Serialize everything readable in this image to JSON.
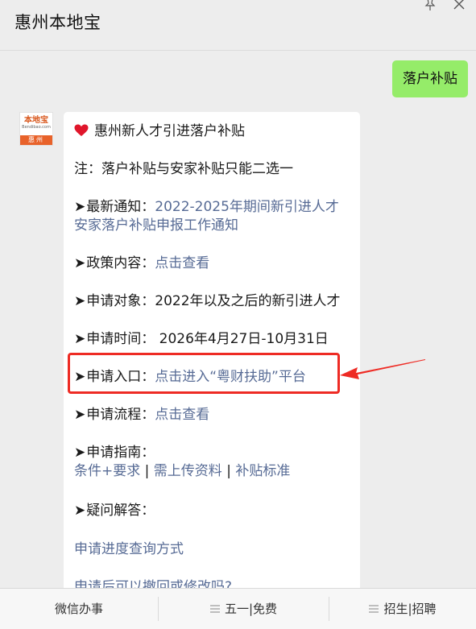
{
  "header": {
    "title": "惠州本地宝"
  },
  "chat": {
    "user_message": "落户补贴",
    "avatar": {
      "brand": "本地宝",
      "site": "Bendibao.com",
      "city": "惠州"
    },
    "reply": {
      "title": "惠州新人才引进落户补贴",
      "note": "注：落户补贴与安家补贴只能二选一",
      "arrow": "➤",
      "latest_label": "最新通知：",
      "latest_link_line1": "2022-2025年期间新引进人才",
      "latest_link_line2": "安家落户补贴申报工作通知",
      "policy_label": "政策内容：",
      "policy_link": "点击查看",
      "target_label": "申请对象：",
      "target_value": "2022年以及之后的新引进人才",
      "time_label": "申请时间：",
      "time_value": "2026年4月27日-10月31日",
      "entry_label": "申请入口：",
      "entry_link": "点击进入“粤财扶助”平台",
      "process_label": "申请流程：",
      "process_link": "点击查看",
      "guide_label": "申请指南：",
      "guide_link_1": "条件+要求",
      "guide_sep_1": " | ",
      "guide_link_2": "需上传资料",
      "guide_sep_2": " | ",
      "guide_link_3": "补贴标准",
      "faq_label": "疑问解答：",
      "faq_link_1": "申请进度查询方式",
      "faq_link_2": "申请后可以撤回或修改吗?"
    }
  },
  "menu": {
    "item_1": "微信办事",
    "item_2": "五一|免费",
    "item_3": "招生|招聘"
  },
  "colors": {
    "bubble_green": "#95ec69",
    "link_blue": "#576b95",
    "highlight_red": "#ee2b24",
    "heart_red": "#e0162b",
    "avatar_orange": "#e8622a"
  }
}
